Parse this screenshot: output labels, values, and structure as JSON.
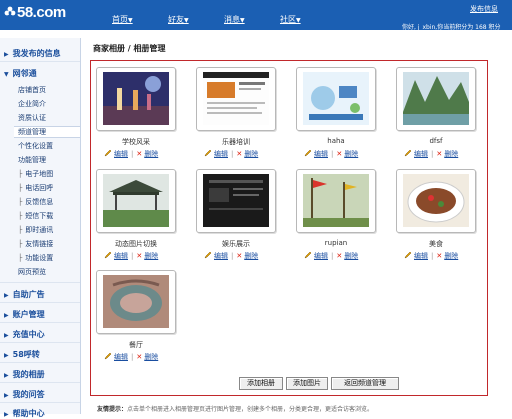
{
  "header": {
    "logo_text": "58.com",
    "nav": [
      "首页",
      "好友",
      "消息",
      "社区"
    ],
    "publish_link": "发布信息",
    "welcome": "你好, j_xbin,你当前积分为 168 积分"
  },
  "sidebar": {
    "sections": [
      "我发布的信息",
      "网邻通",
      "自助广告",
      "账户管理",
      "充值中心",
      "58呼转",
      "我的相册",
      "我的问答",
      "帮助中心"
    ],
    "items": [
      "店铺首页",
      "企业简介",
      "资质认证",
      "频道管理",
      "个性化设置",
      "功能管理",
      "网页预览"
    ],
    "sub_items": [
      "电子地图",
      "电话回呼",
      "反馈信息",
      "短信下载",
      "即时通讯",
      "友情链接",
      "功能设置"
    ]
  },
  "breadcrumb": "商家相册 / 相册管理",
  "albums": [
    {
      "title": "学校风采"
    },
    {
      "title": "乐器培训"
    },
    {
      "title": "haha"
    },
    {
      "title": "dfsf"
    },
    {
      "title": "动态图片切换"
    },
    {
      "title": "娱乐展示"
    },
    {
      "title": "rupian"
    },
    {
      "title": "美食"
    },
    {
      "title": "餐厅"
    }
  ],
  "actions": {
    "edit": "编辑",
    "delete": "删除"
  },
  "buttons": {
    "add_album": "添加相册",
    "add_photo": "添加图片",
    "back": "返回频道管理"
  },
  "tip": {
    "label": "友情提示：",
    "text": "点击单个相册进入相册管理页进行图片管理，创建多个相册，分类更合理，更适合访客浏览。"
  },
  "colors": {
    "header_bg": "#1b5fb3",
    "box_border": "#c1282b",
    "link": "#1a4ea0"
  }
}
